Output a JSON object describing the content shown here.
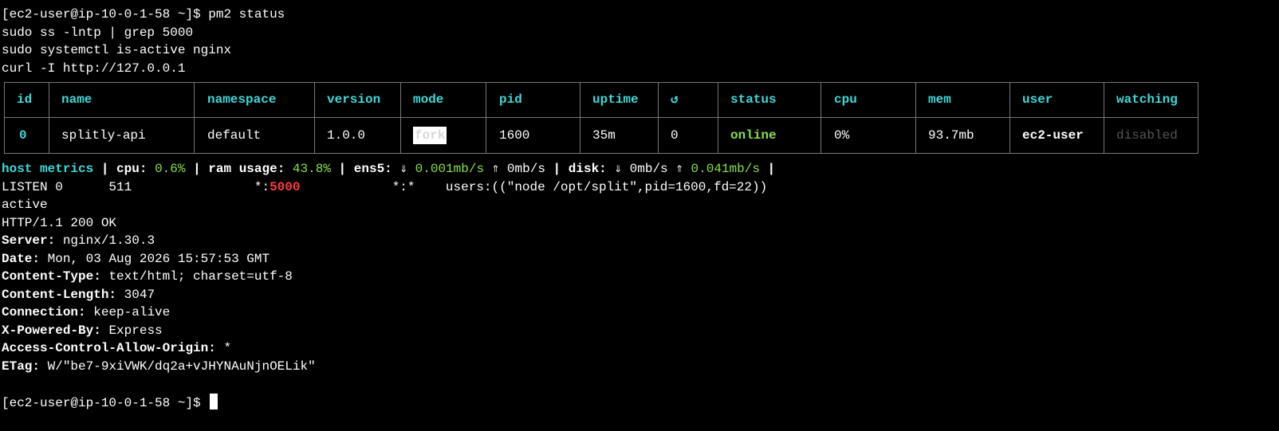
{
  "prompt": "[ec2-user@ip-10-0-1-58 ~]$",
  "commands": [
    "pm2 status",
    "sudo ss -lntp | grep 5000",
    "sudo systemctl is-active nginx",
    "curl -I http://127.0.0.1"
  ],
  "pm2": {
    "headers": {
      "id": "id",
      "name": "name",
      "namespace": "namespace",
      "version": "version",
      "mode": "mode",
      "pid": "pid",
      "uptime": "uptime",
      "restarts": "↺",
      "status": "status",
      "cpu": "cpu",
      "mem": "mem",
      "user": "user",
      "watching": "watching"
    },
    "rows": [
      {
        "id": "0",
        "name": "splitly-api",
        "namespace": "default",
        "version": "1.0.0",
        "mode": "fork",
        "pid": "1600",
        "uptime": "35m",
        "restarts": "0",
        "status": "online",
        "cpu": "0%",
        "mem": "93.7mb",
        "user": "ec2-user",
        "watching": "disabled"
      }
    ]
  },
  "host_metrics": {
    "label": "host metrics",
    "cpu_label": "cpu:",
    "cpu": "0.6%",
    "ram_label": "ram usage:",
    "ram": "43.8%",
    "net_label": "ens5:",
    "net_down_arrow": "⇓",
    "net_down": "0.001mb/s",
    "net_up_arrow": "⇑",
    "net_up": "0mb/s",
    "disk_label": "disk:",
    "disk_down_arrow": "⇓",
    "disk_down": "0mb/s",
    "disk_up_arrow": "⇑",
    "disk_up": "0.041mb/s",
    "sep": "|"
  },
  "ss": {
    "state": "LISTEN 0      511",
    "local_prefix": "*:",
    "local_port": "5000",
    "peer": "*:*",
    "process": "users:((\"node /opt/split\",pid=1600,fd=22))"
  },
  "nginx_status": "active",
  "http": {
    "status_line": "HTTP/1.1 200 OK",
    "headers": [
      {
        "key": "Server:",
        "value": "nginx/1.30.3"
      },
      {
        "key": "Date:",
        "value": "Mon, 03 Aug 2026 15:57:53 GMT"
      },
      {
        "key": "Content-Type:",
        "value": "text/html; charset=utf-8"
      },
      {
        "key": "Content-Length:",
        "value": "3047"
      },
      {
        "key": "Connection:",
        "value": "keep-alive"
      },
      {
        "key": "X-Powered-By:",
        "value": "Express"
      },
      {
        "key": "Access-Control-Allow-Origin:",
        "value": "*"
      },
      {
        "key": "ETag:",
        "value": "W/\"be7-9xiVWK/dq2a+vJHYNAuNjnOELik\""
      }
    ]
  },
  "colors": {
    "background": "#000000",
    "foreground": "#ffffff",
    "cyan": "#3fd9d9",
    "green": "#88e04a",
    "red": "#ff3b3b",
    "border": "#777777"
  }
}
